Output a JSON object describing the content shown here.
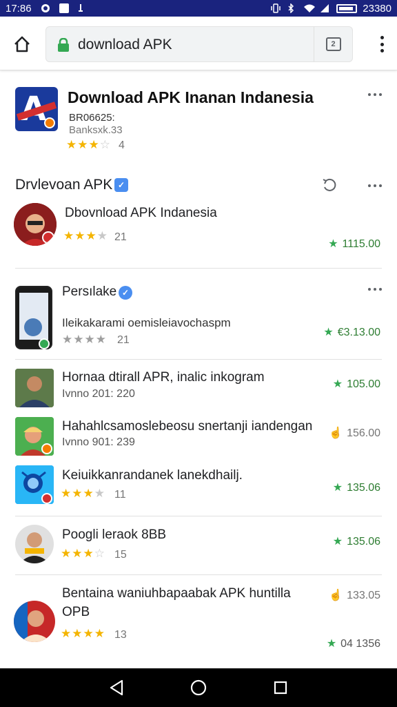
{
  "status_bar": {
    "time": "17:86",
    "right_text": "23380",
    "icons": [
      "whatsapp-icon",
      "notification-icon",
      "location-icon",
      "vibrate-icon",
      "bluetooth-icon",
      "wifi-icon",
      "signal-icon",
      "battery-icon"
    ]
  },
  "toolbar": {
    "url": "download APK",
    "tab_count": "2",
    "accent": "#34a853"
  },
  "featured": {
    "title": "Download APK Inanan Indanesia",
    "sub1": "BR06625:",
    "sub2": "Banksxk.33",
    "stars": 3,
    "rating": "4"
  },
  "section": {
    "title": "Drvlevoan APK"
  },
  "apps": [
    {
      "title": "Dbovnload APK Indanesia",
      "stars": 3.5,
      "rating": "21",
      "downloads": "1115.00"
    },
    {
      "title": "Persılake",
      "sub": "Ileikakarami oemisleiavochaspm",
      "stars": 4,
      "star_color": "grey",
      "rating": "21",
      "downloads": "€3.13.00"
    },
    {
      "title": "Hornaa dtirall APR, inalic inkogram",
      "sub": "Ivnno 201: 220",
      "downloads": "105.00"
    },
    {
      "title": "Hahahlcsamoslebeosu snertanji iandengan",
      "sub": "Ivnno 901: 239",
      "downloads": "156.00"
    },
    {
      "title": "Keiuikkanrandanek lanekdhailj.",
      "stars": 3.5,
      "rating": "11",
      "downloads": "135.06"
    },
    {
      "title": "Poogli leraok 8BB",
      "stars": 3,
      "rating": "15",
      "downloads": "135.06"
    },
    {
      "title": "Bentaina waniuhbapaabak APK huntilla",
      "title2": "OPB",
      "stars": 4,
      "rating": "13",
      "downloads_top": "133.05",
      "downloads": "04 1356"
    }
  ]
}
